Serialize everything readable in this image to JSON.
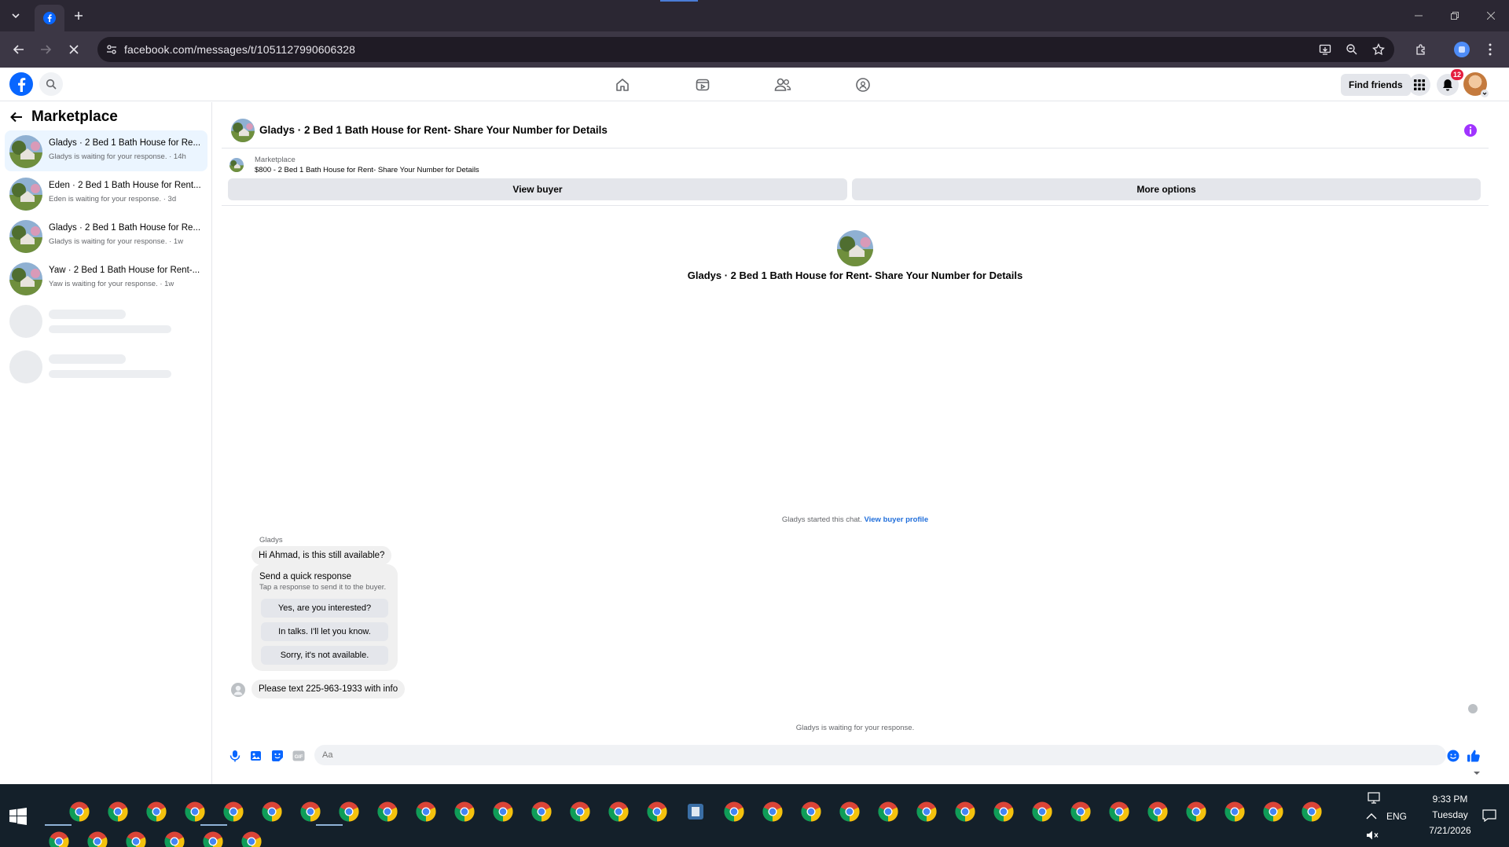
{
  "browser": {
    "url": "facebook.com/messages/t/1051127990606328"
  },
  "facebook": {
    "find_friends_label": "Find friends",
    "notification_count": "12"
  },
  "sidebar": {
    "title": "Marketplace",
    "conversations": [
      {
        "title": "Gladys · 2 Bed 1 Bath House for Re...",
        "subtitle": "Gladys is waiting for your response. · 14h",
        "active": true
      },
      {
        "title": "Eden · 2 Bed 1 Bath House for Rent...",
        "subtitle": "Eden is waiting for your response. · 3d",
        "active": false
      },
      {
        "title": "Gladys · 2 Bed 1 Bath House for Re...",
        "subtitle": "Gladys is waiting for your response. · 1w",
        "active": false
      },
      {
        "title": "Yaw · 2 Bed 1 Bath House for Rent-...",
        "subtitle": "Yaw is waiting for your response. · 1w",
        "active": false
      }
    ]
  },
  "chat": {
    "header_title": "Gladys · 2 Bed 1 Bath House for Rent- Share Your Number for Details",
    "marketplace_label": "Marketplace",
    "listing": "$800 - 2 Bed 1 Bath House for Rent- Share Your Number for Details",
    "view_buyer_label": "View buyer",
    "more_options_label": "More options",
    "hero_title": "Gladys · 2 Bed 1 Bath House for Rent- Share Your Number for Details",
    "started_text": "Gladys started this chat.",
    "view_buyer_profile": "View buyer profile",
    "sender_name": "Gladys",
    "first_message": "Hi Ahmad, is this still available?",
    "quick_response_title": "Send a quick response",
    "quick_response_sub": "Tap a response to send it to the buyer.",
    "quick_responses": [
      "Yes, are you interested?",
      "In talks. I'll let you know.",
      "Sorry, it's not available."
    ],
    "last_message": "Please text 225-963-1933 with info",
    "waiting_text": "Gladys is waiting for your response.",
    "composer_placeholder": "Aa"
  },
  "taskbar": {
    "time": "9:33 PM",
    "day": "Tuesday",
    "date": "7/21/2026",
    "language": "ENG"
  },
  "colors": {
    "fb_blue": "#0866ff",
    "link_blue": "#216fdb",
    "active_conv_bg": "#ebf5ff",
    "badge_red": "#e41e3f",
    "info_purple": "#a033ff"
  }
}
